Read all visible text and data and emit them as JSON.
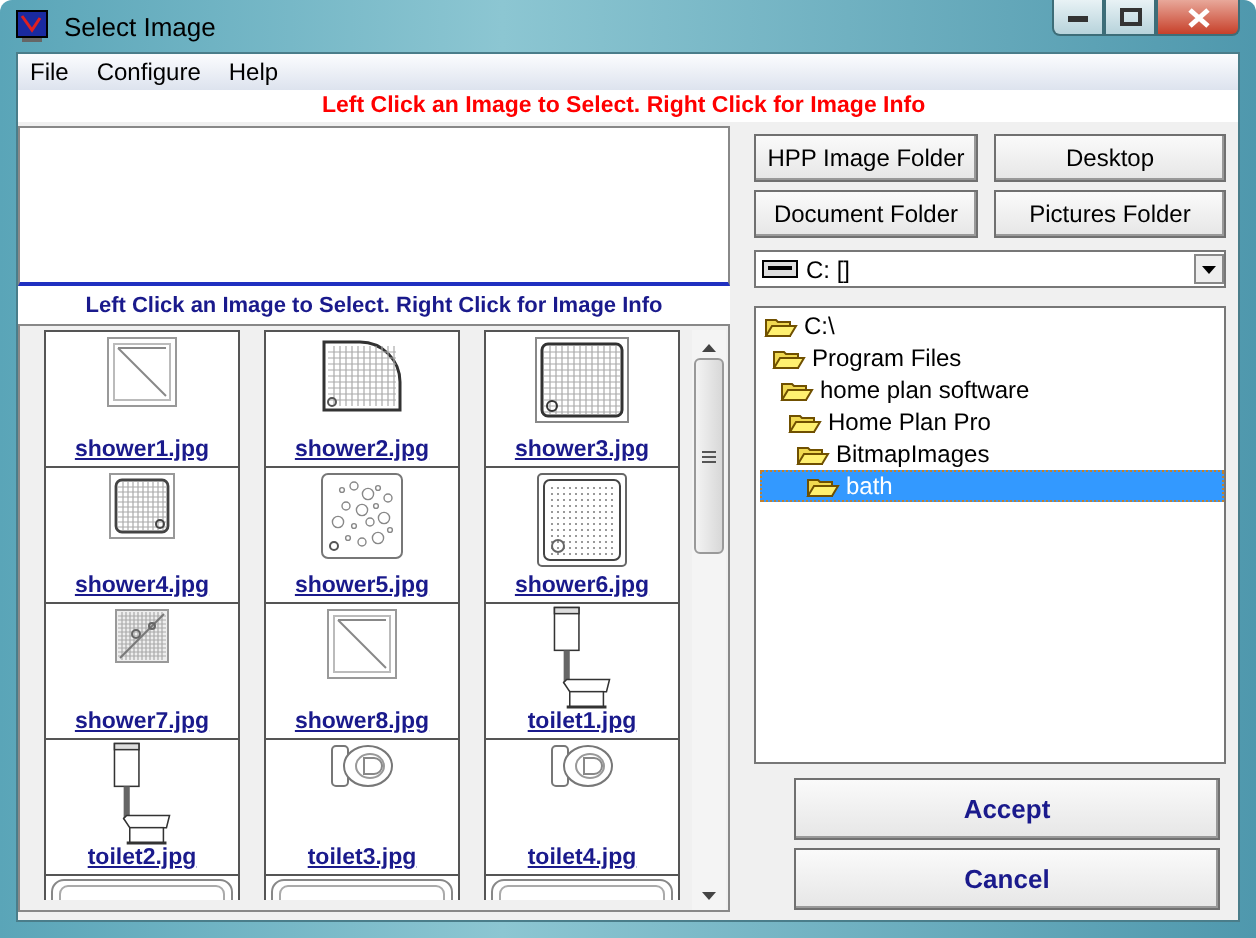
{
  "window": {
    "title": "Select Image"
  },
  "menu": [
    "File",
    "Configure",
    "Help"
  ],
  "hint_top": "Left Click an Image to Select.  Right Click for Image Info",
  "hint_grid": "Left Click an Image to Select.  Right Click for Image Info",
  "thumbnails": [
    {
      "name": "shower1.jpg",
      "kind": "tray-diagonal"
    },
    {
      "name": "shower2.jpg",
      "kind": "tray-quadrant"
    },
    {
      "name": "shower3.jpg",
      "kind": "tray-grid"
    },
    {
      "name": "shower4.jpg",
      "kind": "tray-grid-small"
    },
    {
      "name": "shower5.jpg",
      "kind": "tray-dots"
    },
    {
      "name": "shower6.jpg",
      "kind": "tray-grid-large"
    },
    {
      "name": "shower7.jpg",
      "kind": "tray-mosaic"
    },
    {
      "name": "shower8.jpg",
      "kind": "tray-diagonal"
    },
    {
      "name": "toilet1.jpg",
      "kind": "toilet-high-tank"
    },
    {
      "name": "toilet2.jpg",
      "kind": "toilet-high-tank"
    },
    {
      "name": "toilet3.jpg",
      "kind": "toilet-top"
    },
    {
      "name": "toilet4.jpg",
      "kind": "toilet-top"
    },
    {
      "kind": "bathtub"
    },
    {
      "kind": "bathtub"
    },
    {
      "kind": "bathtub"
    }
  ],
  "folder_buttons": [
    "HPP Image Folder",
    "Desktop",
    "Document Folder",
    "Pictures Folder"
  ],
  "drive": {
    "value": "C: []"
  },
  "tree": [
    {
      "label": "C:\\",
      "selected": false,
      "children": [
        {
          "label": "Program Files",
          "selected": false,
          "children": [
            {
              "label": "home plan software",
              "selected": false,
              "children": [
                {
                  "label": "Home Plan Pro",
                  "selected": false,
                  "children": [
                    {
                      "label": "BitmapImages",
                      "selected": false,
                      "children": [
                        {
                          "label": "bath",
                          "selected": true
                        }
                      ]
                    }
                  ]
                }
              ]
            }
          ]
        }
      ]
    }
  ],
  "buttons": [
    "Accept",
    "Cancel"
  ]
}
